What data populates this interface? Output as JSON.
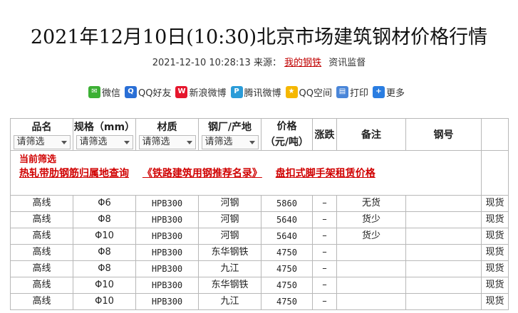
{
  "title": "2021年12月10日(10:30)北京市场建筑钢材价格行情",
  "meta": {
    "datetime": "2021-12-10 10:28:13",
    "source_label": "来源：",
    "source_link": "我的钢铁",
    "category": "资讯监督"
  },
  "share": [
    {
      "icon": "wechat-icon",
      "label": "微信",
      "color": "#3cb034",
      "glyph": "✉"
    },
    {
      "icon": "qq-friend-icon",
      "label": "QQ好友",
      "color": "#2a6fd6",
      "glyph": "Q"
    },
    {
      "icon": "sina-weibo-icon",
      "label": "新浪微博",
      "color": "#e6162d",
      "glyph": "W"
    },
    {
      "icon": "tencent-weibo-icon",
      "label": "腾讯微博",
      "color": "#2b9cd8",
      "glyph": "P"
    },
    {
      "icon": "qq-zone-icon",
      "label": "QQ空间",
      "color": "#f5b700",
      "glyph": "★"
    },
    {
      "icon": "print-icon",
      "label": "打印",
      "color": "#4a86d9",
      "glyph": "▤"
    },
    {
      "icon": "more-icon",
      "label": "更多",
      "color": "#2a7de1",
      "glyph": "+"
    }
  ],
  "table": {
    "headers": {
      "product": "品名",
      "spec": "规格（mm）",
      "material": "材质",
      "mill": "钢厂/产地",
      "price": "价格",
      "price_unit": "（元/吨）",
      "change": "涨跌",
      "note": "备注",
      "steel_no": "钢号"
    },
    "filter_placeholder": "请筛选",
    "current_filter": "当前筛选",
    "links": [
      "热轧带肋钢筋归属地查询",
      "《铁路建筑用钢推荐名录》",
      "盘扣式脚手架租赁价格"
    ],
    "rows": [
      {
        "product": "高线",
        "spec": "Φ6",
        "material": "HPB300",
        "mill": "河钢",
        "price": "5860",
        "change": "–",
        "note": "无货",
        "action": "现货"
      },
      {
        "product": "高线",
        "spec": "Φ8",
        "material": "HPB300",
        "mill": "河钢",
        "price": "5640",
        "change": "–",
        "note": "货少",
        "action": "现货"
      },
      {
        "product": "高线",
        "spec": "Φ10",
        "material": "HPB300",
        "mill": "河钢",
        "price": "5640",
        "change": "–",
        "note": "货少",
        "action": "现货"
      },
      {
        "product": "高线",
        "spec": "Φ8",
        "material": "HPB300",
        "mill": "东华钢铁",
        "price": "4750",
        "change": "–",
        "note": "",
        "action": "现货"
      },
      {
        "product": "高线",
        "spec": "Φ8",
        "material": "HPB300",
        "mill": "九江",
        "price": "4750",
        "change": "–",
        "note": "",
        "action": "现货"
      },
      {
        "product": "高线",
        "spec": "Φ10",
        "material": "HPB300",
        "mill": "东华钢铁",
        "price": "4750",
        "change": "–",
        "note": "",
        "action": "现货"
      },
      {
        "product": "高线",
        "spec": "Φ10",
        "material": "HPB300",
        "mill": "九江",
        "price": "4750",
        "change": "–",
        "note": "",
        "action": "现货"
      }
    ]
  }
}
